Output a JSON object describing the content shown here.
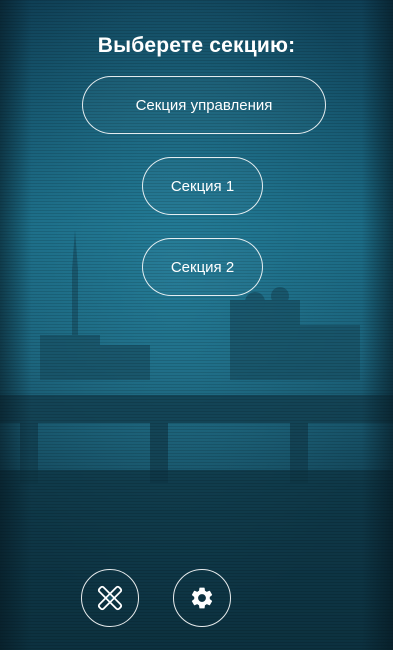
{
  "header": {
    "title": "Выберете секцию:"
  },
  "sections": [
    {
      "label": "Секция управления"
    },
    {
      "label": "Секция 1"
    },
    {
      "label": "Секция 2"
    }
  ],
  "bottom_bar": {
    "close_icon": "close-x-icon",
    "settings_icon": "gear-icon"
  },
  "colors": {
    "background": "#0e2f3d",
    "accent_teal": "#1c6e86",
    "text": "#ffffff"
  }
}
